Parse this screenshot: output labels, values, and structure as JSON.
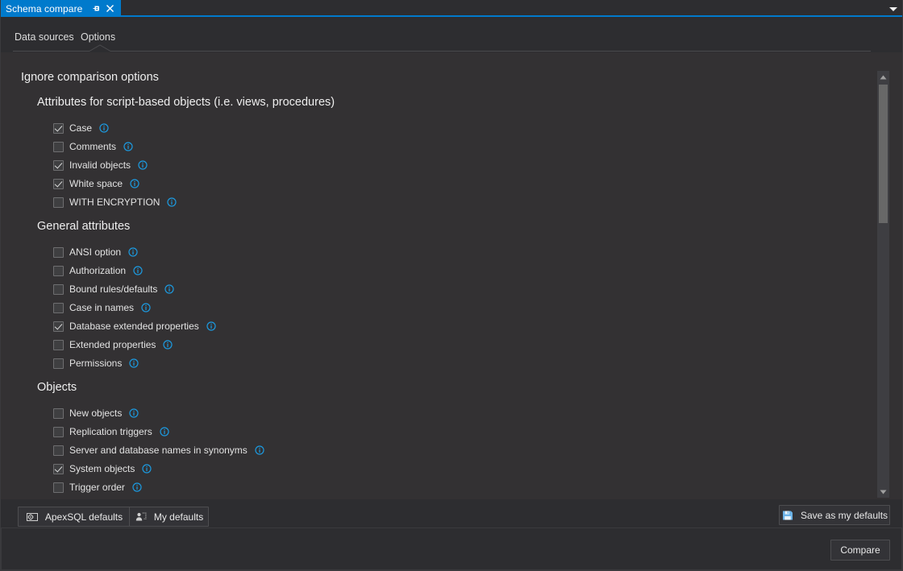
{
  "window": {
    "tab_title": "Schema compare",
    "pin_icon": "pin-icon",
    "close_icon": "close-icon",
    "dropdown_icon": "chevron-down-icon",
    "accent_color": "#007acc",
    "panel_bg": "#333133",
    "chrome_bg": "#2d2d30"
  },
  "tabs": [
    {
      "label": "Data sources",
      "active": false
    },
    {
      "label": "Options",
      "active": true
    }
  ],
  "main": {
    "heading": "Ignore comparison options",
    "groups": [
      {
        "title": "Attributes for script-based objects (i.e. views, procedures)",
        "items": [
          {
            "label": "Case",
            "checked": true
          },
          {
            "label": "Comments",
            "checked": false
          },
          {
            "label": "Invalid objects",
            "checked": true
          },
          {
            "label": "White space",
            "checked": true
          },
          {
            "label": "WITH ENCRYPTION",
            "checked": false
          }
        ]
      },
      {
        "title": "General attributes",
        "items": [
          {
            "label": "ANSI option",
            "checked": false
          },
          {
            "label": "Authorization",
            "checked": false
          },
          {
            "label": "Bound rules/defaults",
            "checked": false
          },
          {
            "label": "Case in names",
            "checked": false
          },
          {
            "label": "Database extended properties",
            "checked": true
          },
          {
            "label": "Extended properties",
            "checked": false
          },
          {
            "label": "Permissions",
            "checked": false
          }
        ]
      },
      {
        "title": "Objects",
        "items": [
          {
            "label": "New objects",
            "checked": false
          },
          {
            "label": "Replication triggers",
            "checked": false
          },
          {
            "label": "Server and database names in synonyms",
            "checked": false
          },
          {
            "label": "System objects",
            "checked": true
          },
          {
            "label": "Trigger order",
            "checked": false
          }
        ]
      }
    ],
    "info_icon": "info-icon"
  },
  "scrollbar": {
    "up_icon": "triangle-up-icon",
    "down_icon": "triangle-down-icon"
  },
  "footer": {
    "apexsql_defaults": {
      "label": "ApexSQL defaults",
      "icon": "monitor-gear-icon"
    },
    "my_defaults": {
      "label": "My defaults",
      "icon": "user-defaults-icon"
    },
    "save_as_my_defaults": {
      "label": "Save as my defaults",
      "icon": "floppy-save-icon",
      "icon_color": "#6cb3e8"
    },
    "compare": {
      "label": "Compare"
    }
  }
}
